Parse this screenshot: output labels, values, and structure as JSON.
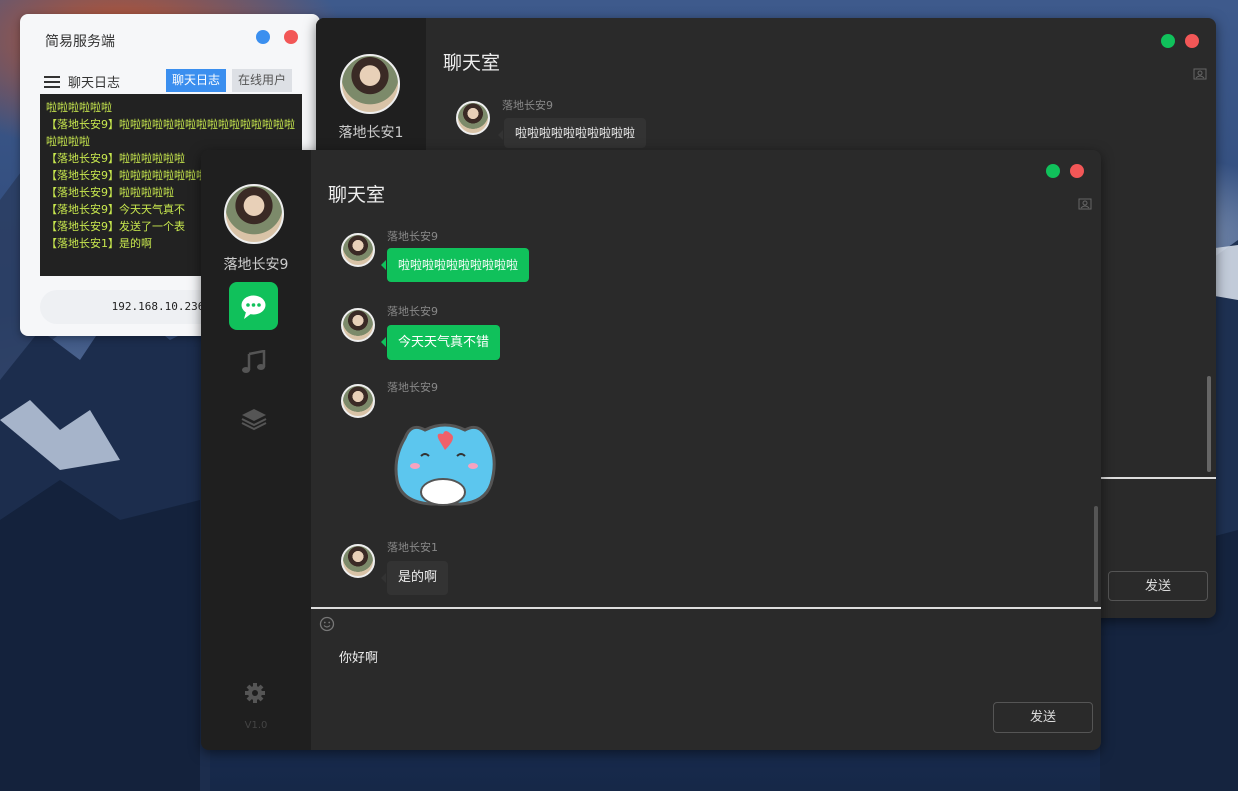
{
  "server": {
    "title": "简易服务端",
    "log_heading": "聊天日志",
    "tabs": [
      {
        "label": "聊天日志",
        "active": true
      },
      {
        "label": "在线用户",
        "active": false
      }
    ],
    "log_lines": [
      "啦啦啦啦啦啦",
      "【落地长安9】啦啦啦啦啦啦啦啦啦啦啦啦啦啦啦啦啦啦啦啦",
      "【落地长安9】啦啦啦啦啦啦",
      "【落地长安9】啦啦啦啦啦啦啦啦啦啦啦啦",
      "【落地长安9】啦啦啦啦啦",
      "【落地长安9】今天天气真不",
      "【落地长安9】发送了一个表",
      "【落地长安1】是的啊"
    ],
    "ip": "192.168.10.236"
  },
  "back_window": {
    "username": "落地长安1",
    "room_title": "聊天室",
    "message": {
      "sender": "落地长安9",
      "text": "啦啦啦啦啦啦啦啦啦啦"
    },
    "send_label": "发送"
  },
  "front_window": {
    "username": "落地长安9",
    "room_title": "聊天室",
    "messages": [
      {
        "sender": "落地长安9",
        "text": "啦啦啦啦啦啦啦啦啦啦",
        "style": "green"
      },
      {
        "sender": "落地长安9",
        "text": "今天天气真不错",
        "style": "green"
      },
      {
        "sender": "落地长安9",
        "text": "",
        "style": "sticker"
      },
      {
        "sender": "落地长安1",
        "text": "是的啊",
        "style": "dark"
      }
    ],
    "input_value": "你好啊",
    "send_label": "发送",
    "version": "V1.0"
  },
  "colors": {
    "accent_green": "#10c15b",
    "close_red": "#f25757",
    "min_blue": "#3b8fef",
    "log_text": "#c8e84e"
  }
}
